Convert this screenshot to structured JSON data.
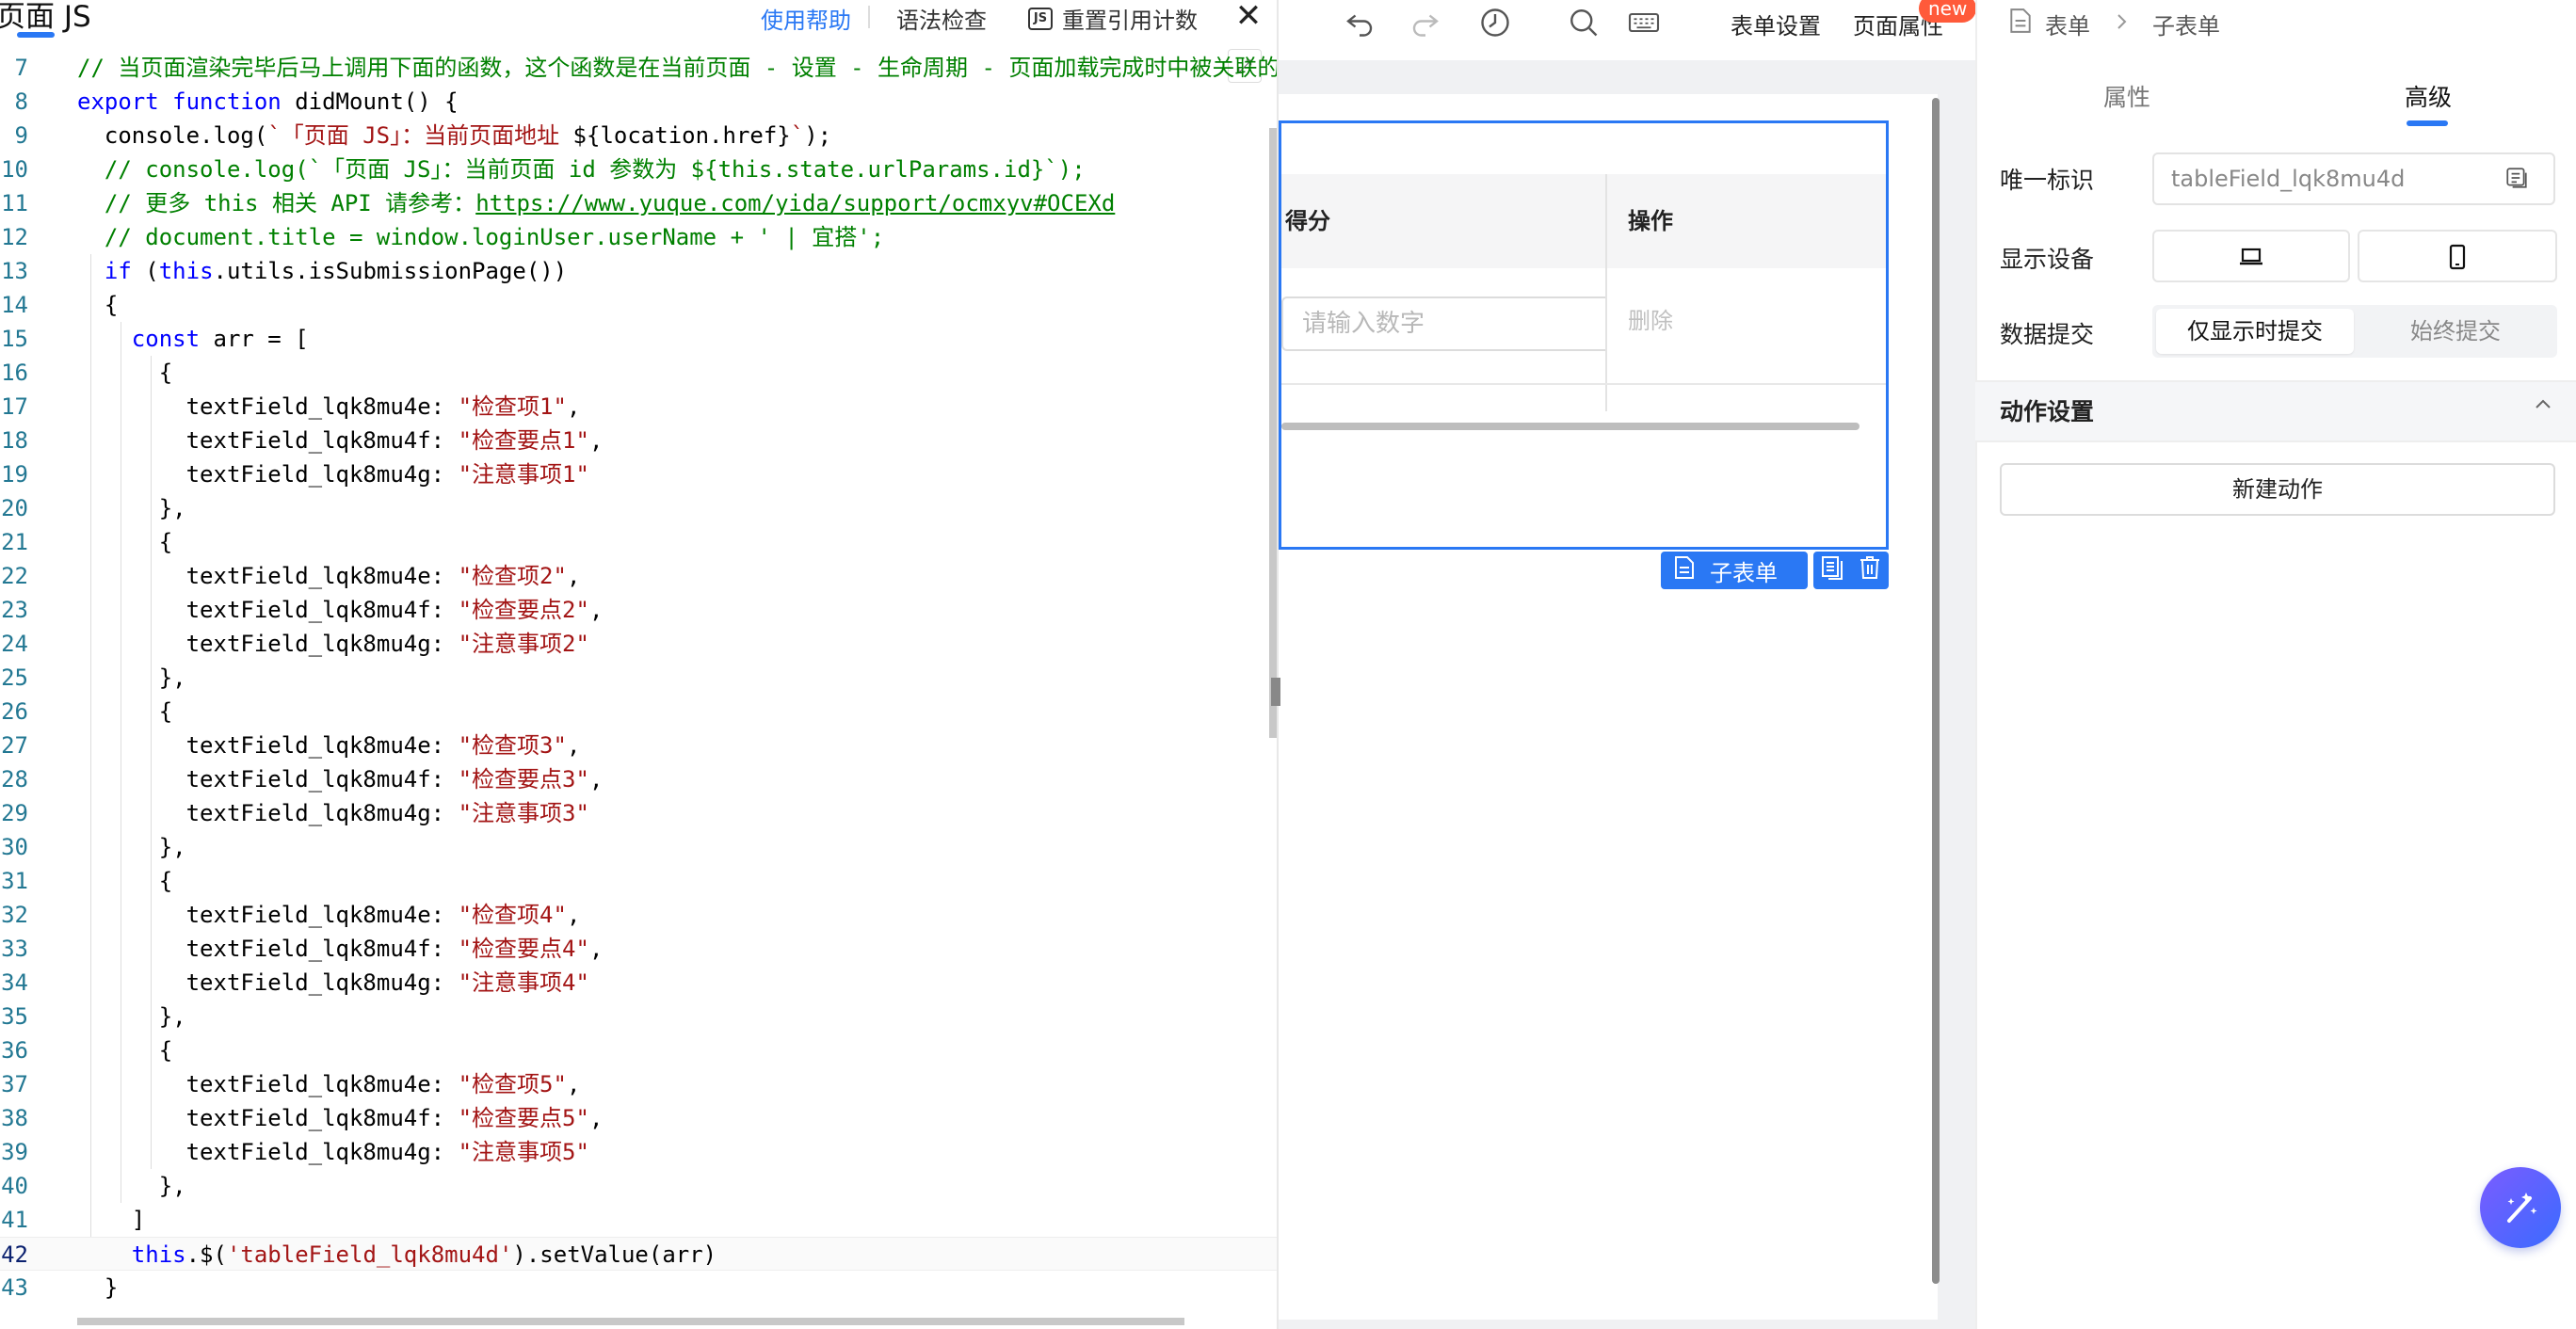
{
  "editor": {
    "title": "页面 JS",
    "help_label": "使用帮助",
    "syntax_label": "语法检查",
    "reset_label": "重置引用计数",
    "js_badge": "JS",
    "close_label": "✕",
    "expand_label": "⤢",
    "lines": [
      {
        "n": "7",
        "t": [
          [
            "cm",
            "// 当页面渲染完毕后马上调用下面的函数，这个函数是在当前页面 - 设置 - 生命周期 - 页面加载完成时中被关联的"
          ]
        ]
      },
      {
        "n": "8",
        "t": [
          [
            "kw",
            "export"
          ],
          [
            "",
            " "
          ],
          [
            "kw",
            "function"
          ],
          [
            "",
            " didMount() {"
          ]
        ]
      },
      {
        "n": "9",
        "t": [
          [
            "",
            "  console.log("
          ],
          [
            "str",
            "`「页面 JS」：当前页面地址 "
          ],
          [
            "",
            "${location.href}"
          ],
          [
            "str",
            "`"
          ],
          [
            "",
            ");"
          ]
        ]
      },
      {
        "n": "10",
        "t": [
          [
            "cm",
            "  // console.log(`「页面 JS」：当前页面 id 参数为 ${this.state.urlParams.id}`);"
          ]
        ]
      },
      {
        "n": "11",
        "t": [
          [
            "cm",
            "  // 更多 this 相关 API 请参考："
          ],
          [
            "url",
            "https://www.yuque.com/yida/support/ocmxyv#OCEXd"
          ]
        ]
      },
      {
        "n": "12",
        "t": [
          [
            "cm",
            "  // document.title = window.loginUser.userName + ' | 宜搭';"
          ]
        ]
      },
      {
        "n": "13",
        "t": [
          [
            "",
            "  "
          ],
          [
            "kw",
            "if"
          ],
          [
            "",
            " ("
          ],
          [
            "kw",
            "this"
          ],
          [
            "",
            ".utils.isSubmissionPage())"
          ]
        ]
      },
      {
        "n": "14",
        "t": [
          [
            "",
            "  {"
          ]
        ]
      },
      {
        "n": "15",
        "t": [
          [
            "",
            "    "
          ],
          [
            "kw",
            "const"
          ],
          [
            "",
            " arr = ["
          ]
        ]
      },
      {
        "n": "16",
        "t": [
          [
            "",
            "      {"
          ]
        ]
      },
      {
        "n": "17",
        "t": [
          [
            "",
            "        textField_lqk8mu4e: "
          ],
          [
            "str",
            "\"检查项1\""
          ],
          [
            "",
            ","
          ]
        ]
      },
      {
        "n": "18",
        "t": [
          [
            "",
            "        textField_lqk8mu4f: "
          ],
          [
            "str",
            "\"检查要点1\""
          ],
          [
            "",
            ","
          ]
        ]
      },
      {
        "n": "19",
        "t": [
          [
            "",
            "        textField_lqk8mu4g: "
          ],
          [
            "str",
            "\"注意事项1\""
          ]
        ]
      },
      {
        "n": "20",
        "t": [
          [
            "",
            "      },"
          ]
        ]
      },
      {
        "n": "21",
        "t": [
          [
            "",
            "      {"
          ]
        ]
      },
      {
        "n": "22",
        "t": [
          [
            "",
            "        textField_lqk8mu4e: "
          ],
          [
            "str",
            "\"检查项2\""
          ],
          [
            "",
            ","
          ]
        ]
      },
      {
        "n": "23",
        "t": [
          [
            "",
            "        textField_lqk8mu4f: "
          ],
          [
            "str",
            "\"检查要点2\""
          ],
          [
            "",
            ","
          ]
        ]
      },
      {
        "n": "24",
        "t": [
          [
            "",
            "        textField_lqk8mu4g: "
          ],
          [
            "str",
            "\"注意事项2\""
          ]
        ]
      },
      {
        "n": "25",
        "t": [
          [
            "",
            "      },"
          ]
        ]
      },
      {
        "n": "26",
        "t": [
          [
            "",
            "      {"
          ]
        ]
      },
      {
        "n": "27",
        "t": [
          [
            "",
            "        textField_lqk8mu4e: "
          ],
          [
            "str",
            "\"检查项3\""
          ],
          [
            "",
            ","
          ]
        ]
      },
      {
        "n": "28",
        "t": [
          [
            "",
            "        textField_lqk8mu4f: "
          ],
          [
            "str",
            "\"检查要点3\""
          ],
          [
            "",
            ","
          ]
        ]
      },
      {
        "n": "29",
        "t": [
          [
            "",
            "        textField_lqk8mu4g: "
          ],
          [
            "str",
            "\"注意事项3\""
          ]
        ]
      },
      {
        "n": "30",
        "t": [
          [
            "",
            "      },"
          ]
        ]
      },
      {
        "n": "31",
        "t": [
          [
            "",
            "      {"
          ]
        ]
      },
      {
        "n": "32",
        "t": [
          [
            "",
            "        textField_lqk8mu4e: "
          ],
          [
            "str",
            "\"检查项4\""
          ],
          [
            "",
            ","
          ]
        ]
      },
      {
        "n": "33",
        "t": [
          [
            "",
            "        textField_lqk8mu4f: "
          ],
          [
            "str",
            "\"检查要点4\""
          ],
          [
            "",
            ","
          ]
        ]
      },
      {
        "n": "34",
        "t": [
          [
            "",
            "        textField_lqk8mu4g: "
          ],
          [
            "str",
            "\"注意事项4\""
          ]
        ]
      },
      {
        "n": "35",
        "t": [
          [
            "",
            "      },"
          ]
        ]
      },
      {
        "n": "36",
        "t": [
          [
            "",
            "      {"
          ]
        ]
      },
      {
        "n": "37",
        "t": [
          [
            "",
            "        textField_lqk8mu4e: "
          ],
          [
            "str",
            "\"检查项5\""
          ],
          [
            "",
            ","
          ]
        ]
      },
      {
        "n": "38",
        "t": [
          [
            "",
            "        textField_lqk8mu4f: "
          ],
          [
            "str",
            "\"检查要点5\""
          ],
          [
            "",
            ","
          ]
        ]
      },
      {
        "n": "39",
        "t": [
          [
            "",
            "        textField_lqk8mu4g: "
          ],
          [
            "str",
            "\"注意事项5\""
          ]
        ]
      },
      {
        "n": "40",
        "t": [
          [
            "",
            "      },"
          ]
        ]
      },
      {
        "n": "41",
        "t": [
          [
            "",
            "    ]"
          ]
        ]
      },
      {
        "n": "42",
        "t": [
          [
            "",
            "    "
          ],
          [
            "kw",
            "this"
          ],
          [
            "",
            ".$("
          ],
          [
            "str",
            "'tableField_lqk8mu4d'"
          ],
          [
            "",
            ").setValue(arr)"
          ]
        ],
        "current": true
      },
      {
        "n": "43",
        "t": [
          [
            "",
            "  }"
          ]
        ]
      }
    ]
  },
  "toolbar": {
    "undo_icon": "undo-icon",
    "redo_icon": "redo-icon",
    "history_icon": "history-icon",
    "search_icon": "search-icon",
    "keyboard_icon": "keyboard-icon",
    "form_settings_label": "表单设置",
    "page_props_label": "页面属性",
    "new_badge": "new"
  },
  "canvas": {
    "score_header": "得分",
    "action_header": "操作",
    "score_placeholder": "请输入数字",
    "delete_label": "删除",
    "subform_tag_label": "子表单"
  },
  "panel": {
    "breadcrumb": [
      "表单",
      "子表单"
    ],
    "tabs": [
      {
        "label": "属性",
        "active": false
      },
      {
        "label": "高级",
        "active": true
      }
    ],
    "uid_label": "唯一标识",
    "uid_value": "tableField_lqk8mu4d",
    "device_label": "显示设备",
    "submit_label": "数据提交",
    "submit_options": [
      "仅显示时提交",
      "始终提交"
    ],
    "submit_selected": 0,
    "action_section_title": "动作设置",
    "new_action_label": "新建动作"
  },
  "colors": {
    "accent": "#2a78f4",
    "keyword": "#0000ff",
    "comment": "#008000",
    "string": "#a31515",
    "new_badge": "#ff5a3a"
  }
}
